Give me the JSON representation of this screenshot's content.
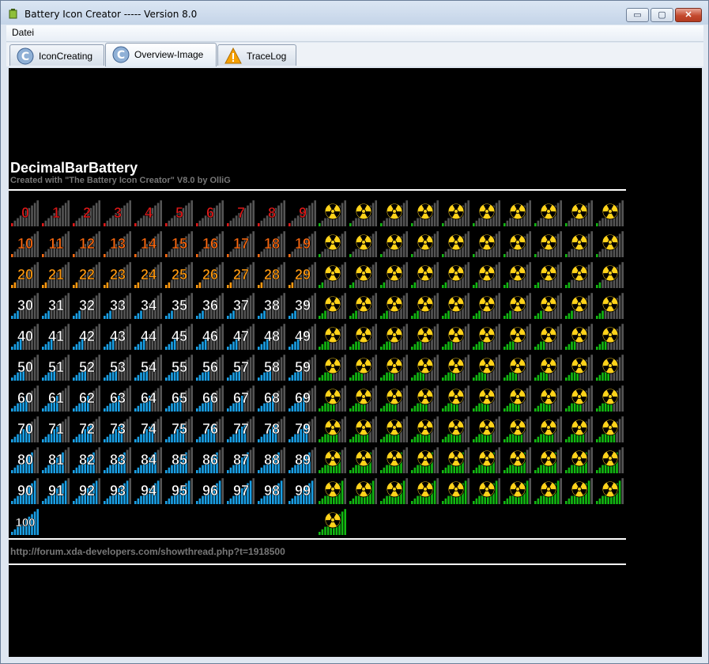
{
  "window": {
    "title": "Battery Icon Creator ----- Version 8.0",
    "buttons": {
      "minimize": "▭",
      "maximize": "▢",
      "close": "✕"
    }
  },
  "menu": {
    "items": [
      "Datei"
    ]
  },
  "tabs": [
    {
      "label": "IconCreating",
      "icon": "blue-c-icon",
      "active": false
    },
    {
      "label": "Overview-Image",
      "icon": "blue-c-icon",
      "active": true
    },
    {
      "label": "TraceLog",
      "icon": "warning-icon",
      "active": false
    }
  ],
  "overview": {
    "title": "DecimalBarBattery",
    "subtitle": "Created with \"The Battery Icon Creator\" V8.0 by OlliG",
    "footer_url": "http://forum.xda-developers.com/showthread.php?t=1918500",
    "levels": [
      "0",
      "1",
      "2",
      "3",
      "4",
      "5",
      "6",
      "7",
      "8",
      "9",
      "10",
      "11",
      "12",
      "13",
      "14",
      "15",
      "16",
      "17",
      "18",
      "19",
      "20",
      "21",
      "22",
      "23",
      "24",
      "25",
      "26",
      "27",
      "28",
      "29",
      "30",
      "31",
      "32",
      "33",
      "34",
      "35",
      "36",
      "37",
      "38",
      "39",
      "40",
      "41",
      "42",
      "43",
      "44",
      "45",
      "46",
      "47",
      "48",
      "49",
      "50",
      "51",
      "52",
      "53",
      "54",
      "55",
      "56",
      "57",
      "58",
      "59",
      "60",
      "61",
      "62",
      "63",
      "64",
      "65",
      "66",
      "67",
      "68",
      "69",
      "70",
      "71",
      "72",
      "73",
      "74",
      "75",
      "76",
      "77",
      "78",
      "79",
      "80",
      "81",
      "82",
      "83",
      "84",
      "85",
      "86",
      "87",
      "88",
      "89",
      "90",
      "91",
      "92",
      "93",
      "94",
      "95",
      "96",
      "97",
      "98",
      "99",
      "100"
    ],
    "colors": {
      "critical": "#e01818",
      "low": "#ff6a10",
      "medium": "#ff9a10",
      "normal": "#1aa0e6",
      "charging": "#12b812",
      "empty_bar": "#555555",
      "text_normal": "#ffffff"
    },
    "charging_icon": "radiation-icon"
  }
}
